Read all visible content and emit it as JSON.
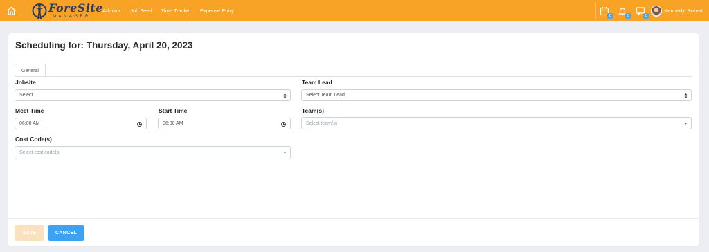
{
  "topbar": {
    "logo_main": "ForeSite",
    "logo_sub": "MANAGER",
    "nav": [
      {
        "label": "Admin",
        "dropdown": true
      },
      {
        "label": "Job Feed"
      },
      {
        "label": "Time Tracker"
      },
      {
        "label": "Expense Entry"
      }
    ],
    "badges": {
      "calendar": "0",
      "bell": "0",
      "chat": "0"
    },
    "user_name": "Kennedy, Robert",
    "accent_color": "#f8a325"
  },
  "page": {
    "title": "Scheduling for: Thursday, April 20, 2023",
    "tab_general": "General"
  },
  "form": {
    "jobsite_label": "Jobsite",
    "jobsite_value": "Select...",
    "team_lead_label": "Team Lead",
    "team_lead_value": "Select Team Lead...",
    "meet_time_label": "Meet Time",
    "meet_time_value": "06:00 AM",
    "start_time_label": "Start Time",
    "start_time_value": "06:00 AM",
    "teams_label": "Team(s)",
    "teams_placeholder": "Select team(s)",
    "cost_codes_label": "Cost Code(s)",
    "cost_codes_placeholder": "Select cost code(s)"
  },
  "buttons": {
    "save": "SAVE",
    "cancel": "CANCEL",
    "cancel_color": "#3da2f2"
  }
}
